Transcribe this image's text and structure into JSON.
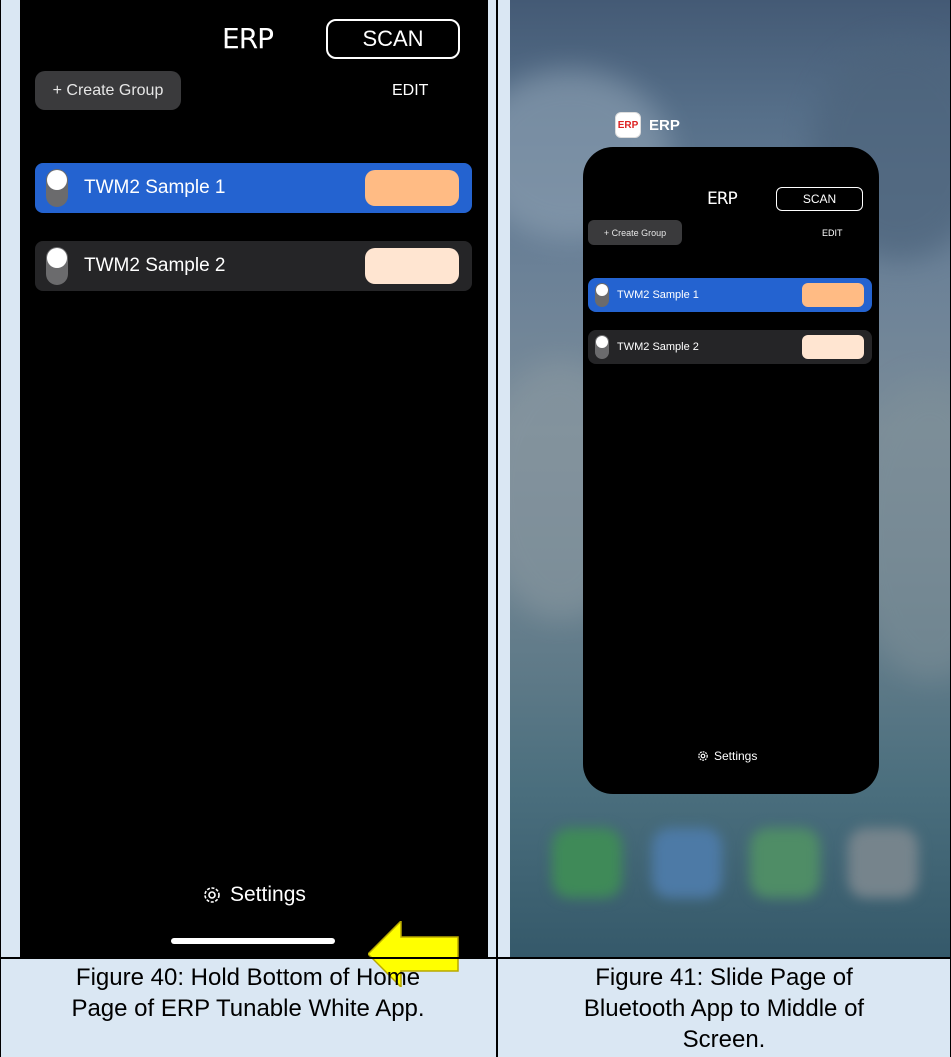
{
  "left_phone": {
    "logo": "ERP",
    "scan_label": "SCAN",
    "create_group_label": "+ Create Group",
    "edit_label": "EDIT",
    "groups": [
      {
        "label": "TWM2 Sample 1",
        "selected": true,
        "swatch_color": "#ffbb84"
      },
      {
        "label": "TWM2 Sample 2",
        "selected": false,
        "swatch_color": "#ffe5d1"
      }
    ],
    "settings_label": "Settings"
  },
  "right_switcher": {
    "app_name": "ERP",
    "app_icon_text": "ERP",
    "card": {
      "logo": "ERP",
      "scan_label": "SCAN",
      "create_group_label": "+ Create Group",
      "edit_label": "EDIT",
      "groups": [
        {
          "label": "TWM2 Sample 1",
          "selected": true,
          "swatch_color": "#ffbb84"
        },
        {
          "label": "TWM2 Sample 2",
          "selected": false,
          "swatch_color": "#ffe5d1"
        }
      ],
      "settings_label": "Settings"
    }
  },
  "captions": {
    "left": [
      "Figure 40: Hold Bottom of Home",
      "Page of ERP Tunable White App."
    ],
    "right": [
      "Figure 41: Slide Page of",
      "Bluetooth App to Middle of",
      "Screen."
    ]
  },
  "colors": {
    "selected_row": "#2463d0",
    "unselected_row": "#252527",
    "arrow": "#ffff00",
    "table_bg": "#dae7f3"
  },
  "icons": [
    "gear-icon",
    "arrow-left-icon",
    "erp-app-icon"
  ]
}
